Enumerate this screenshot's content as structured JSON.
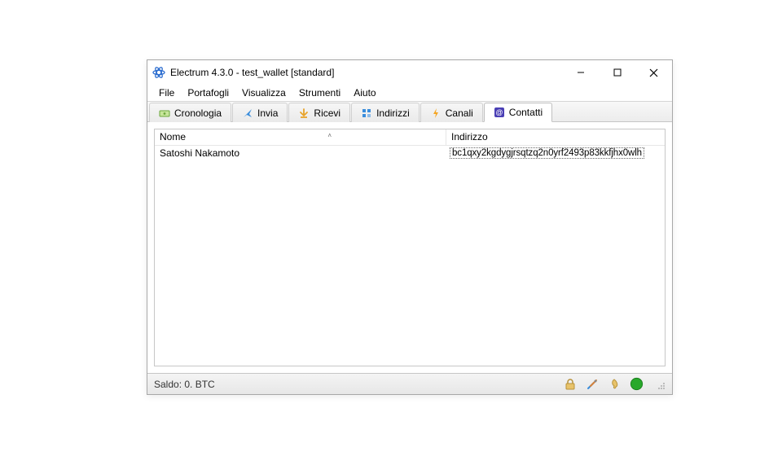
{
  "window": {
    "title": "Electrum 4.3.0  -  test_wallet  [standard]"
  },
  "menu": {
    "file": "File",
    "wallet": "Portafogli",
    "view": "Visualizza",
    "tools": "Strumenti",
    "help": "Aiuto"
  },
  "tabs": {
    "history": "Cronologia",
    "send": "Invia",
    "receive": "Ricevi",
    "addresses": "Indirizzi",
    "channels": "Canali",
    "contacts": "Contatti"
  },
  "table": {
    "headers": {
      "name": "Nome",
      "address": "Indirizzo"
    },
    "rows": [
      {
        "name": "Satoshi Nakamoto",
        "address": "bc1qxy2kgdygjrsqtzq2n0yrf2493p83kkfjhx0wlh"
      }
    ]
  },
  "status": {
    "balance": "Saldo: 0. BTC"
  },
  "colors": {
    "accent_blue": "#2f6fd0",
    "green": "#28a82b",
    "orange": "#e8a32a"
  }
}
